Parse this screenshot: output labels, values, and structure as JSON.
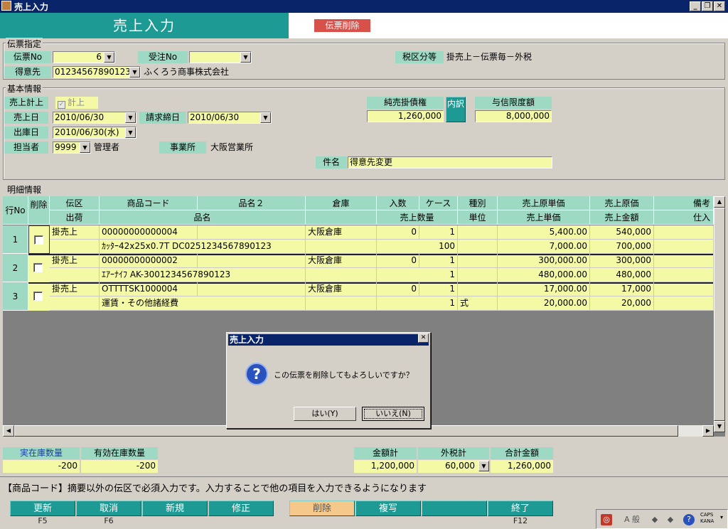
{
  "window": {
    "title": "売上入力"
  },
  "header": {
    "title": "売上入力",
    "delete_badge": "伝票削除"
  },
  "slip": {
    "legend": "伝票指定",
    "slip_no_label": "伝票No",
    "slip_no": "6",
    "order_no_label": "受注No",
    "order_no": "",
    "tax_label": "税区分等",
    "tax_value": "掛売上－伝票毎－外税",
    "customer_label": "得意先",
    "customer_code": "01234567890123",
    "customer_name": "ふくろう商事株式会社"
  },
  "basic": {
    "legend": "基本情報",
    "post_label": "売上計上",
    "post_check_label": "計上",
    "sales_date_label": "売上日",
    "sales_date": "2010/06/30",
    "close_date_label": "請求締日",
    "close_date": "2010/06/30",
    "ship_date_label": "出庫日",
    "ship_date": "2010/06/30(水)",
    "staff_label": "担当者",
    "staff_code": "9999",
    "staff_name": "管理者",
    "office_label": "事業所",
    "office_name": "大阪営業所",
    "receivable_label": "純売掛債権",
    "receivable": "1,260,000",
    "breakdown_button": "内訳",
    "credit_label": "与信限度額",
    "credit": "8,000,000",
    "subject_label": "件名",
    "subject": "得意先変更"
  },
  "detail": {
    "legend": "明細情報",
    "headers_top": [
      "行No",
      "削除",
      "伝区",
      "商品コード",
      "品名２",
      "倉庫",
      "入数",
      "ケース",
      "種別",
      "売上原単価",
      "売上原価",
      "備考"
    ],
    "headers_bottom": [
      "出荷",
      "品名",
      "売上数量",
      "単位",
      "売上単価",
      "売上金額",
      "仕入"
    ],
    "rows": [
      {
        "no": "1",
        "kind": "掛売上",
        "code": "00000000000004",
        "warehouse": "大阪倉庫",
        "per_case": "0",
        "cases": "1",
        "type": "",
        "cost_unit": "5,400.00",
        "cost": "540,000",
        "name": "ｶｯﾀｰ42x25x0.7T DC0251234567890123",
        "qty": "100",
        "unit": "",
        "price": "7,000.00",
        "amount": "700,000"
      },
      {
        "no": "2",
        "kind": "掛売上",
        "code": "00000000000002",
        "warehouse": "大阪倉庫",
        "per_case": "0",
        "cases": "1",
        "type": "",
        "cost_unit": "300,000.00",
        "cost": "300,000",
        "name": "ｴｱｰﾅｲﾌ AK-3001234567890123",
        "qty": "1",
        "unit": "",
        "price": "480,000.00",
        "amount": "480,000"
      },
      {
        "no": "3",
        "kind": "掛売上",
        "code": "OTTTTSK1000004",
        "warehouse": "大阪倉庫",
        "per_case": "0",
        "cases": "1",
        "type": "",
        "cost_unit": "17,000.00",
        "cost": "17,000",
        "name": "運賃・その他諸経費",
        "qty": "1",
        "unit": "式",
        "price": "20,000.00",
        "amount": "20,000"
      }
    ]
  },
  "dialog": {
    "title": "売上入力",
    "message": "この伝票を削除してもよろしいですか？",
    "yes": "はい(Y)",
    "no": "いいえ(N)",
    "icon": "question-icon"
  },
  "stock": {
    "actual_label": "実在庫数量",
    "actual": "-200",
    "available_label": "有効在庫数量",
    "available": "-200"
  },
  "totals": {
    "amount_label": "金額計",
    "amount": "1,200,000",
    "tax_label": "外税計",
    "tax": "60,000",
    "total_label": "合計金額",
    "total": "1,260,000"
  },
  "status_message": "【商品コード】摘要以外の伝区で必須入力です。入力することで他の項目を入力できるようになります",
  "fkeys": [
    {
      "label": "更新",
      "key": "F5"
    },
    {
      "label": "取消",
      "key": "F6"
    },
    {
      "label": "新規",
      "key": ""
    },
    {
      "label": "修正",
      "key": ""
    },
    {
      "label": "削除",
      "key": ""
    },
    {
      "label": "複写",
      "key": ""
    },
    {
      "label": "",
      "key": ""
    },
    {
      "label": "終了",
      "key": "F12"
    }
  ],
  "tray": {
    "caps": "CAPS",
    "kana": "KANA",
    "ime": "A 般"
  },
  "colors": {
    "header": "#1d9a94",
    "label": "#9ed9c4",
    "input": "#f4f9a6",
    "badge": "#d8504a",
    "titlebar": "#0a246a"
  }
}
